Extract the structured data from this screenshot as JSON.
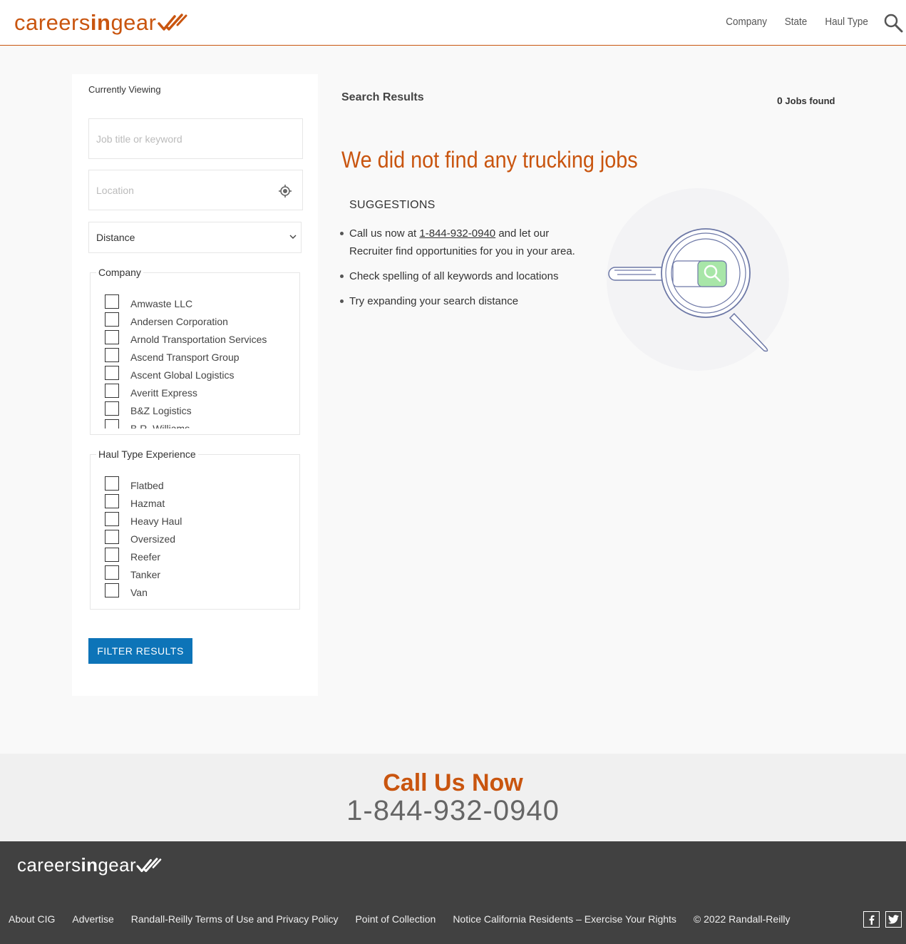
{
  "header": {
    "logo": {
      "part1": "careers",
      "part2": "in",
      "part3": "gear"
    },
    "nav": [
      "Company",
      "State",
      "Haul Type"
    ]
  },
  "sidebar": {
    "currently_viewing": "Currently Viewing",
    "keyword_placeholder": "Job title or keyword",
    "location_placeholder": "Location",
    "distance_label": "Distance",
    "company": {
      "legend": "Company",
      "items": [
        "Amwaste LLC",
        "Andersen Corporation",
        "Arnold Transportation Services",
        "Ascend Transport Group",
        "Ascent Global Logistics",
        "Averitt Express",
        "B&Z Logistics",
        "B.R. Williams"
      ]
    },
    "haul": {
      "legend": "Haul Type Experience",
      "items": [
        "Flatbed",
        "Hazmat",
        "Heavy Haul",
        "Oversized",
        "Reefer",
        "Tanker",
        "Van"
      ]
    },
    "filter_button": "FILTER RESULTS"
  },
  "main": {
    "results_title": "Search Results",
    "jobs_count": "0",
    "jobs_label": "Jobs found",
    "not_found": "We did not find any trucking jobs",
    "suggestions_heading": "SUGGESTIONS",
    "suggestion1_pre": "Call us now at ",
    "suggestion1_phone": "1-844-932-0940",
    "suggestion1_post": " and let our Recruiter find opportunities for you in your area.",
    "suggestion2": "Check spelling of all keywords and locations",
    "suggestion3": "Try expanding your search distance"
  },
  "call_band": {
    "title": "Call Us Now",
    "phone": "1-844-932-0940"
  },
  "footer": {
    "links": [
      "About CIG",
      "Advertise",
      "Randall-Reilly Terms of Use and Privacy Policy",
      "Point of Collection",
      "Notice California Residents – Exercise Your Rights"
    ],
    "copyright": "© 2022 Randall-Reilly"
  },
  "colors": {
    "brand": "#c9550f",
    "button": "#0d74b8",
    "footer": "#414141",
    "search_green": "#a8e6a8"
  }
}
